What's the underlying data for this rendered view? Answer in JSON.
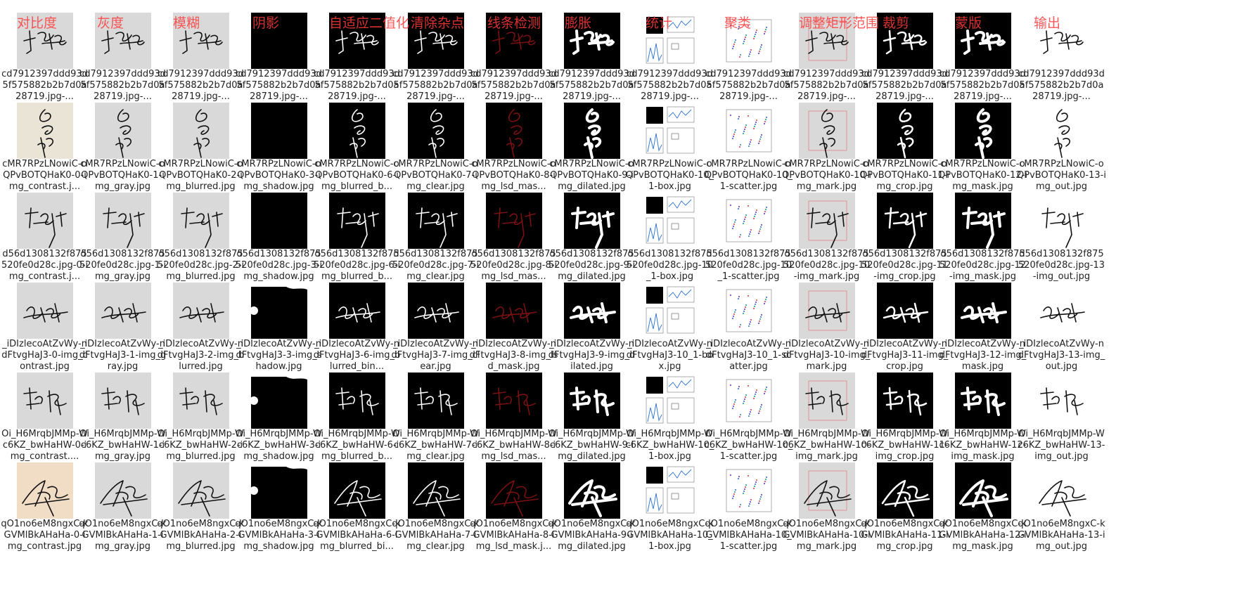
{
  "headers": [
    "对比度",
    "灰度",
    "模糊",
    "阴影",
    "自适应二值化",
    "清除杂点",
    "线条检测",
    "膨胀",
    "统计",
    "聚类",
    "调整矩形范围",
    "裁剪",
    "蒙版",
    "输出"
  ],
  "rows": [
    {
      "sig": "a",
      "labels": [
        "cd7912397ddd93d5f575882b2b7d0a28719.jpg-...",
        "cd7912397ddd93d5f575882b2b7d0a28719.jpg-...",
        "cd7912397ddd93d5f575882b2b7d0a28719.jpg-...",
        "cd7912397ddd93d5f575882b2b7d0a28719.jpg-...",
        "cd7912397ddd93d5f575882b2b7d0a28719.jpg-...",
        "cd7912397ddd93d5f575882b2b7d0a28719.jpg-...",
        "cd7912397ddd93d5f575882b2b7d0a28719.jpg-...",
        "cd7912397ddd93d5f575882b2b7d0a28719.jpg-...",
        "cd7912397ddd93d5f575882b2b7d0a28719.jpg-...",
        "cd7912397ddd93d5f575882b2b7d0a28719.jpg-...",
        "cd7912397ddd93d5f575882b2b7d0a28719.jpg-...",
        "cd7912397ddd93d5f575882b2b7d0a28719.jpg-...",
        "cd7912397ddd93d5f575882b2b7d0a28719.jpg-...",
        "cd7912397ddd93d5f575882b2b7d0a28719.jpg-..."
      ]
    },
    {
      "sig": "b",
      "labels": [
        "cMR7RPzLNowiC-oQPvBOTQHaK0-0-img_contrast.j...",
        "cMR7RPzLNowiC-oQPvBOTQHaK0-1-img_gray.jpg",
        "cMR7RPzLNowiC-oQPvBOTQHaK0-2-img_blurred.jpg",
        "cMR7RPzLNowiC-oQPvBOTQHaK0-3-img_shadow.jpg",
        "cMR7RPzLNowiC-oQPvBOTQHaK0-6-img_blurred_b...",
        "cMR7RPzLNowiC-oQPvBOTQHaK0-7-img_clear.jpg",
        "cMR7RPzLNowiC-oQPvBOTQHaK0-8-img_lsd_mas...",
        "cMR7RPzLNowiC-oQPvBOTQHaK0-9-img_dilated.jpg",
        "cMR7RPzLNowiC-oQPvBOTQHaK0-10_1-box.jpg",
        "cMR7RPzLNowiC-oQPvBOTQHaK0-10_1-scatter.jpg",
        "cMR7RPzLNowiC-oQPvBOTQHaK0-10-img_mark.jpg",
        "cMR7RPzLNowiC-oQPvBOTQHaK0-11-img_crop.jpg",
        "cMR7RPzLNowiC-oQPvBOTQHaK0-12-img_mask.jpg",
        "cMR7RPzLNowiC-oQPvBOTQHaK0-13-img_out.jpg"
      ]
    },
    {
      "sig": "c",
      "labels": [
        "d56d1308132f875520fe0d28c.jpg-0-img_contrast.j...",
        "d56d1308132f875520fe0d28c.jpg-1-img_gray.jpg",
        "d56d1308132f875520fe0d28c.jpg-2-img_blurred.jpg",
        "d56d1308132f875520fe0d28c.jpg-3-img_shadow.jpg",
        "d56d1308132f875520fe0d28c.jpg-6-img_blurred_b...",
        "d56d1308132f875520fe0d28c.jpg-7-img_clear.jpg",
        "d56d1308132f875520fe0d28c.jpg-8-img_lsd_mas...",
        "d56d1308132f875520fe0d28c.jpg-9-img_dilated.jpg",
        "d56d1308132f875520fe0d28c.jpg-10_1-box.jpg",
        "d56d1308132f875520fe0d28c.jpg-10_1-scatter.jpg",
        "d56d1308132f875520fe0d28c.jpg-10-img_mark.jpg",
        "d56d1308132f875520fe0d28c.jpg-11-img_crop.jpg",
        "d56d1308132f875520fe0d28c.jpg-12-img_mask.jpg",
        "d56d1308132f875520fe0d28c.jpg-13-img_out.jpg"
      ]
    },
    {
      "sig": "d",
      "labels": [
        "_iDIzlecoAtZvWy-ndFtvgHaJ3-0-img_contrast.jpg",
        "_iDIzlecoAtZvWy-ndFtvgHaJ3-1-img_gray.jpg",
        "_iDIzlecoAtZvWy-ndFtvgHaJ3-2-img_blurred.jpg",
        "_iDIzlecoAtZvWy-ndFtvgHaJ3-3-img_shadow.jpg",
        "_iDIzlecoAtZvWy-ndFtvgHaJ3-6-img_blurred_bin...",
        "_iDIzlecoAtZvWy-ndFtvgHaJ3-7-img_clear.jpg",
        "_iDIzlecoAtZvWy-ndFtvgHaJ3-8-img_lsd_mask.jpg",
        "_iDIzlecoAtZvWy-ndFtvgHaJ3-9-img_dilated.jpg",
        "_iDIzlecoAtZvWy-ndFtvgHaJ3-10_1-box.jpg",
        "_iDIzlecoAtZvWy-ndFtvgHaJ3-10_1-scatter.jpg",
        "_iDIzlecoAtZvWy-ndFtvgHaJ3-10-img_mark.jpg",
        "_iDIzlecoAtZvWy-ndFtvgHaJ3-11-img_crop.jpg",
        "_iDIzlecoAtZvWy-ndFtvgHaJ3-12-img_mask.jpg",
        "_iDIzlecoAtZvWy-ndFtvgHaJ3-13-img_out.jpg"
      ]
    },
    {
      "sig": "e",
      "labels": [
        "Oi_H6MrqbJMMp-Wc6KZ_bwHaHW-0-img_contrast....",
        "Oi_H6MrqbJMMp-Wc6KZ_bwHaHW-1-img_gray.jpg",
        "Oi_H6MrqbJMMp-Wc6KZ_bwHaHW-2-img_blurred.jpg",
        "Oi_H6MrqbJMMp-Wc6KZ_bwHaHW-3-img_shadow.jpg",
        "Oi_H6MrqbJMMp-Wc6KZ_bwHaHW-6-img_blurred_b...",
        "Oi_H6MrqbJMMp-Wc6KZ_bwHaHW-7-img_clear.jpg",
        "Oi_H6MrqbJMMp-Wc6KZ_bwHaHW-8-img_lsd_mas...",
        "Oi_H6MrqbJMMp-Wc6KZ_bwHaHW-9-img_dilated.jpg",
        "Oi_H6MrqbJMMp-Wc6KZ_bwHaHW-10_1-box.jpg",
        "Oi_H6MrqbJMMp-Wc6KZ_bwHaHW-10_1-scatter.jpg",
        "Oi_H6MrqbJMMp-Wc6KZ_bwHaHW-10-img_mark.jpg",
        "Oi_H6MrqbJMMp-Wc6KZ_bwHaHW-11-img_crop.jpg",
        "Oi_H6MrqbJMMp-Wc6KZ_bwHaHW-12-img_mask.jpg",
        "Oi_H6MrqbJMMp-Wc6KZ_bwHaHW-13-img_out.jpg"
      ]
    },
    {
      "sig": "f",
      "labels": [
        "qO1no6eM8ngxC-kGVMlBkAHaHa-0-img_contrast.jpg",
        "qO1no6eM8ngxC-kGVMlBkAHaHa-1-img_gray.jpg",
        "qO1no6eM8ngxC-kGVMlBkAHaHa-2-img_blurred.jpg",
        "qO1no6eM8ngxC-kGVMlBkAHaHa-3-img_shadow.jpg",
        "qO1no6eM8ngxC-kGVMlBkAHaHa-6-img_blurred_bi...",
        "qO1no6eM8ngxC-kGVMlBkAHaHa-7-img_clear.jpg",
        "qO1no6eM8ngxC-kGVMlBkAHaHa-8-img_lsd_mask.j...",
        "qO1no6eM8ngxC-kGVMlBkAHaHa-9-img_dilated.jpg",
        "qO1no6eM8ngxC-kGVMlBkAHaHa-10_1-box.jpg",
        "qO1no6eM8ngxC-kGVMlBkAHaHa-10_1-scatter.jpg",
        "qO1no6eM8ngxC-kGVMlBkAHaHa-10-img_mark.jpg",
        "qO1no6eM8ngxC-kGVMlBkAHaHa-11-img_crop.jpg",
        "qO1no6eM8ngxC-kGVMlBkAHaHa-12-img_mask.jpg",
        "qO1no6eM8ngxC-kGVMlBkAHaHa-13-img_out.jpg"
      ]
    }
  ],
  "colors": {
    "header": "#ff3b3b",
    "ink": "#111111",
    "inkLight": "#ffffff",
    "lsd": "#7a1010",
    "paper": "#d9d9d9",
    "contrast_f": "#f1dcc5",
    "contrast_b": "#e9e4d6"
  }
}
